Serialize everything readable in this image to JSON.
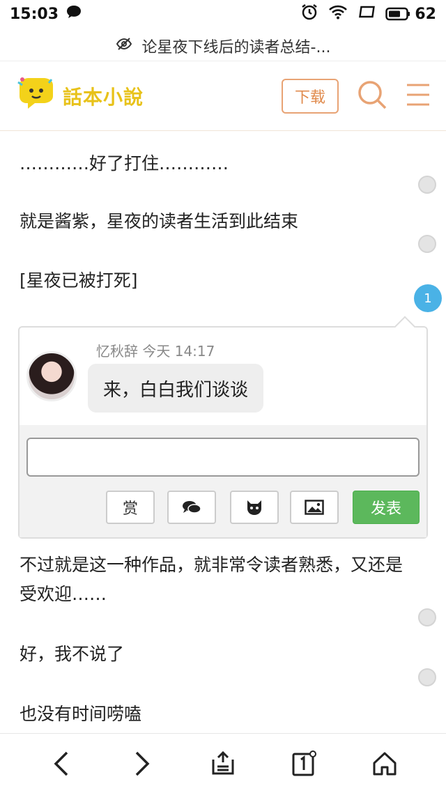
{
  "status_bar": {
    "time": "15:03",
    "battery": "62",
    "icons": [
      "message-icon",
      "alarm-icon",
      "wifi-icon",
      "screen-icon",
      "battery-icon"
    ]
  },
  "url_bar": {
    "title": "论星夜下线后的读者总结-..."
  },
  "header": {
    "logo_text": "話本小說",
    "download_label": "下载",
    "accent": "#e08a4c"
  },
  "content": {
    "paragraphs": [
      "…………好了打住…………",
      "就是酱紫，星夜的读者生活到此结束",
      "[星夜已被打死]",
      "不过就是这一种作品，就非常令读者熟悉，又还是受欢迎……",
      "好，我不说了",
      "也没有时间唠嗑"
    ],
    "comment_count_badge": "1"
  },
  "comment": {
    "author": "忆秋辞",
    "time": "今天 14:17",
    "text": "来，白白我们谈谈",
    "reply_placeholder": "",
    "reward_label": "赏",
    "post_label": "发表",
    "post_color": "#5cb85c"
  },
  "bottom_nav": [
    "back-icon",
    "forward-icon",
    "share-icon",
    "tabs-icon",
    "home-icon"
  ]
}
